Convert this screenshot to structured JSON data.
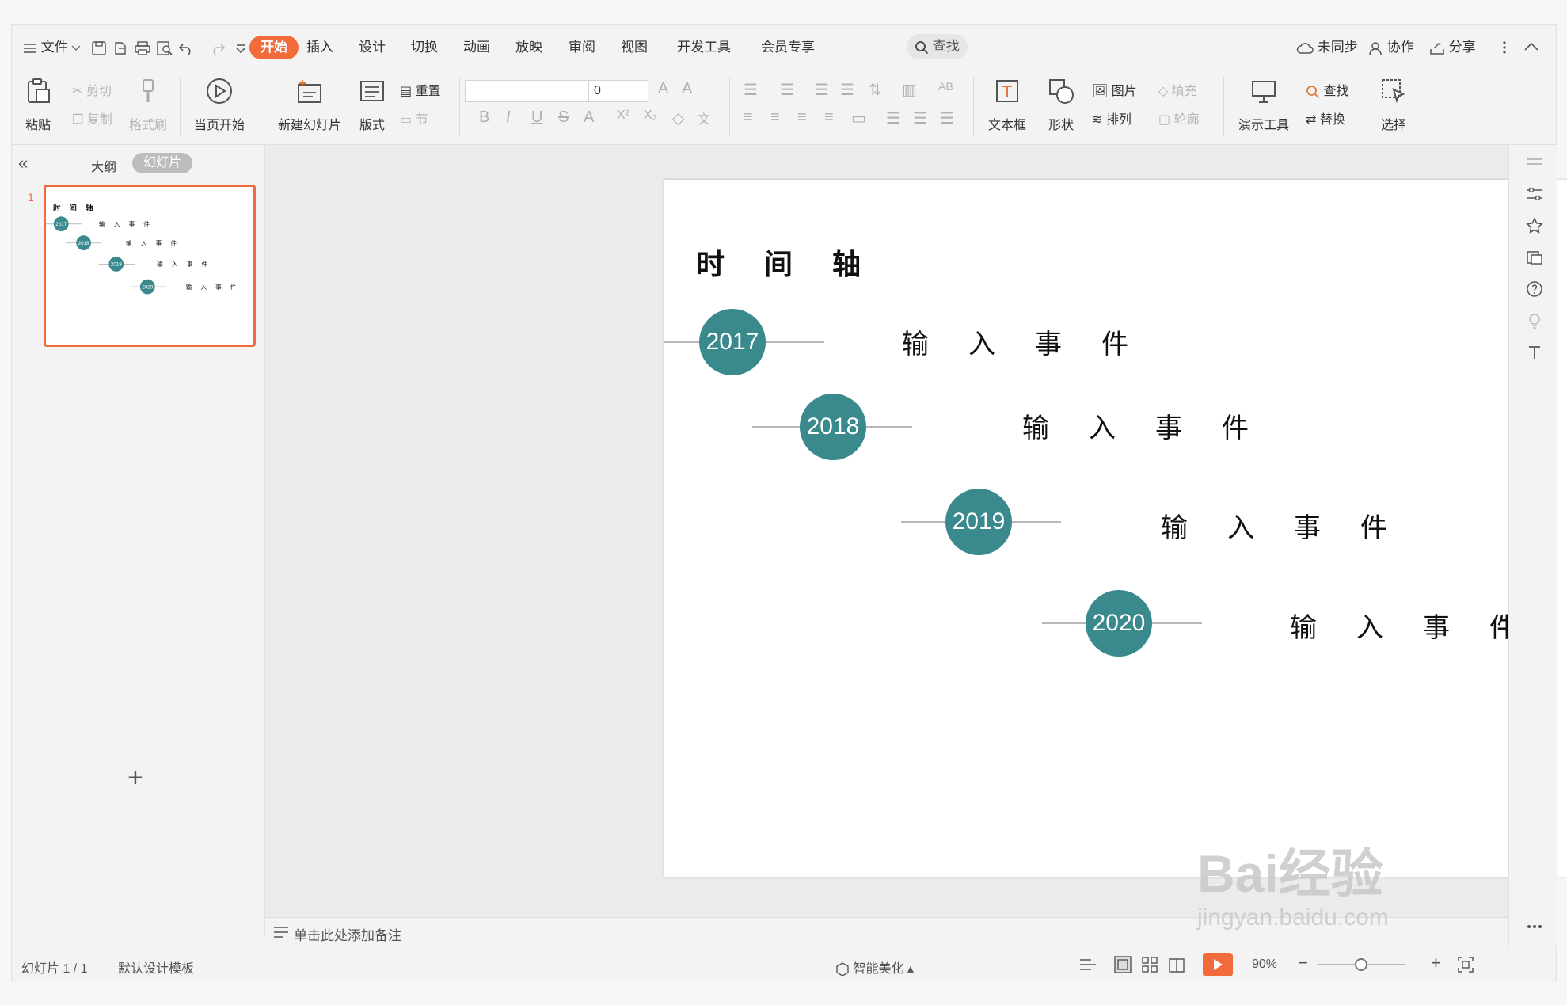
{
  "menu": {
    "hamburger_label": "文件",
    "tabs": [
      "开始",
      "插入",
      "设计",
      "切换",
      "动画",
      "放映",
      "审阅",
      "视图",
      "开发工具",
      "会员专享"
    ],
    "search_label": "查找",
    "right": {
      "sync": "未同步",
      "collab": "协作",
      "share": "分享"
    }
  },
  "ribbon": {
    "paste": "粘贴",
    "cut": "剪切",
    "copy": "复制",
    "format_painter": "格式刷",
    "play_from_current": "当页开始",
    "new_slide": "新建幻灯片",
    "layout": "版式",
    "reset": "重置",
    "section": "节",
    "font_size_value": "0",
    "textbox": "文本框",
    "shape": "形状",
    "picture": "图片",
    "fill": "填充",
    "arrange": "排列",
    "outline": "轮廓",
    "presentation_tools": "演示工具",
    "find": "查找",
    "replace": "替换",
    "select": "选择"
  },
  "left_panel": {
    "tab_outline": "大纲",
    "tab_slides": "幻灯片",
    "slide_number": "1",
    "add_label": "+"
  },
  "slide": {
    "title": "时间轴",
    "events": [
      {
        "year": "2017",
        "text": "输入事件"
      },
      {
        "year": "2018",
        "text": "输入事件"
      },
      {
        "year": "2019",
        "text": "输入事件"
      },
      {
        "year": "2020",
        "text": "输入事件"
      }
    ],
    "accent_color": "#3a8a8d"
  },
  "notes": {
    "placeholder": "单击此处添加备注"
  },
  "status": {
    "slide_counter": "幻灯片 1 / 1",
    "template": "默认设计模板",
    "beautify": "智能美化",
    "zoom": "90%"
  },
  "watermark": {
    "brand": "Bai经验",
    "url": "jingyan.baidu.com"
  },
  "colors": {
    "brand": "#f26b3a",
    "teal": "#3a8a8d"
  }
}
